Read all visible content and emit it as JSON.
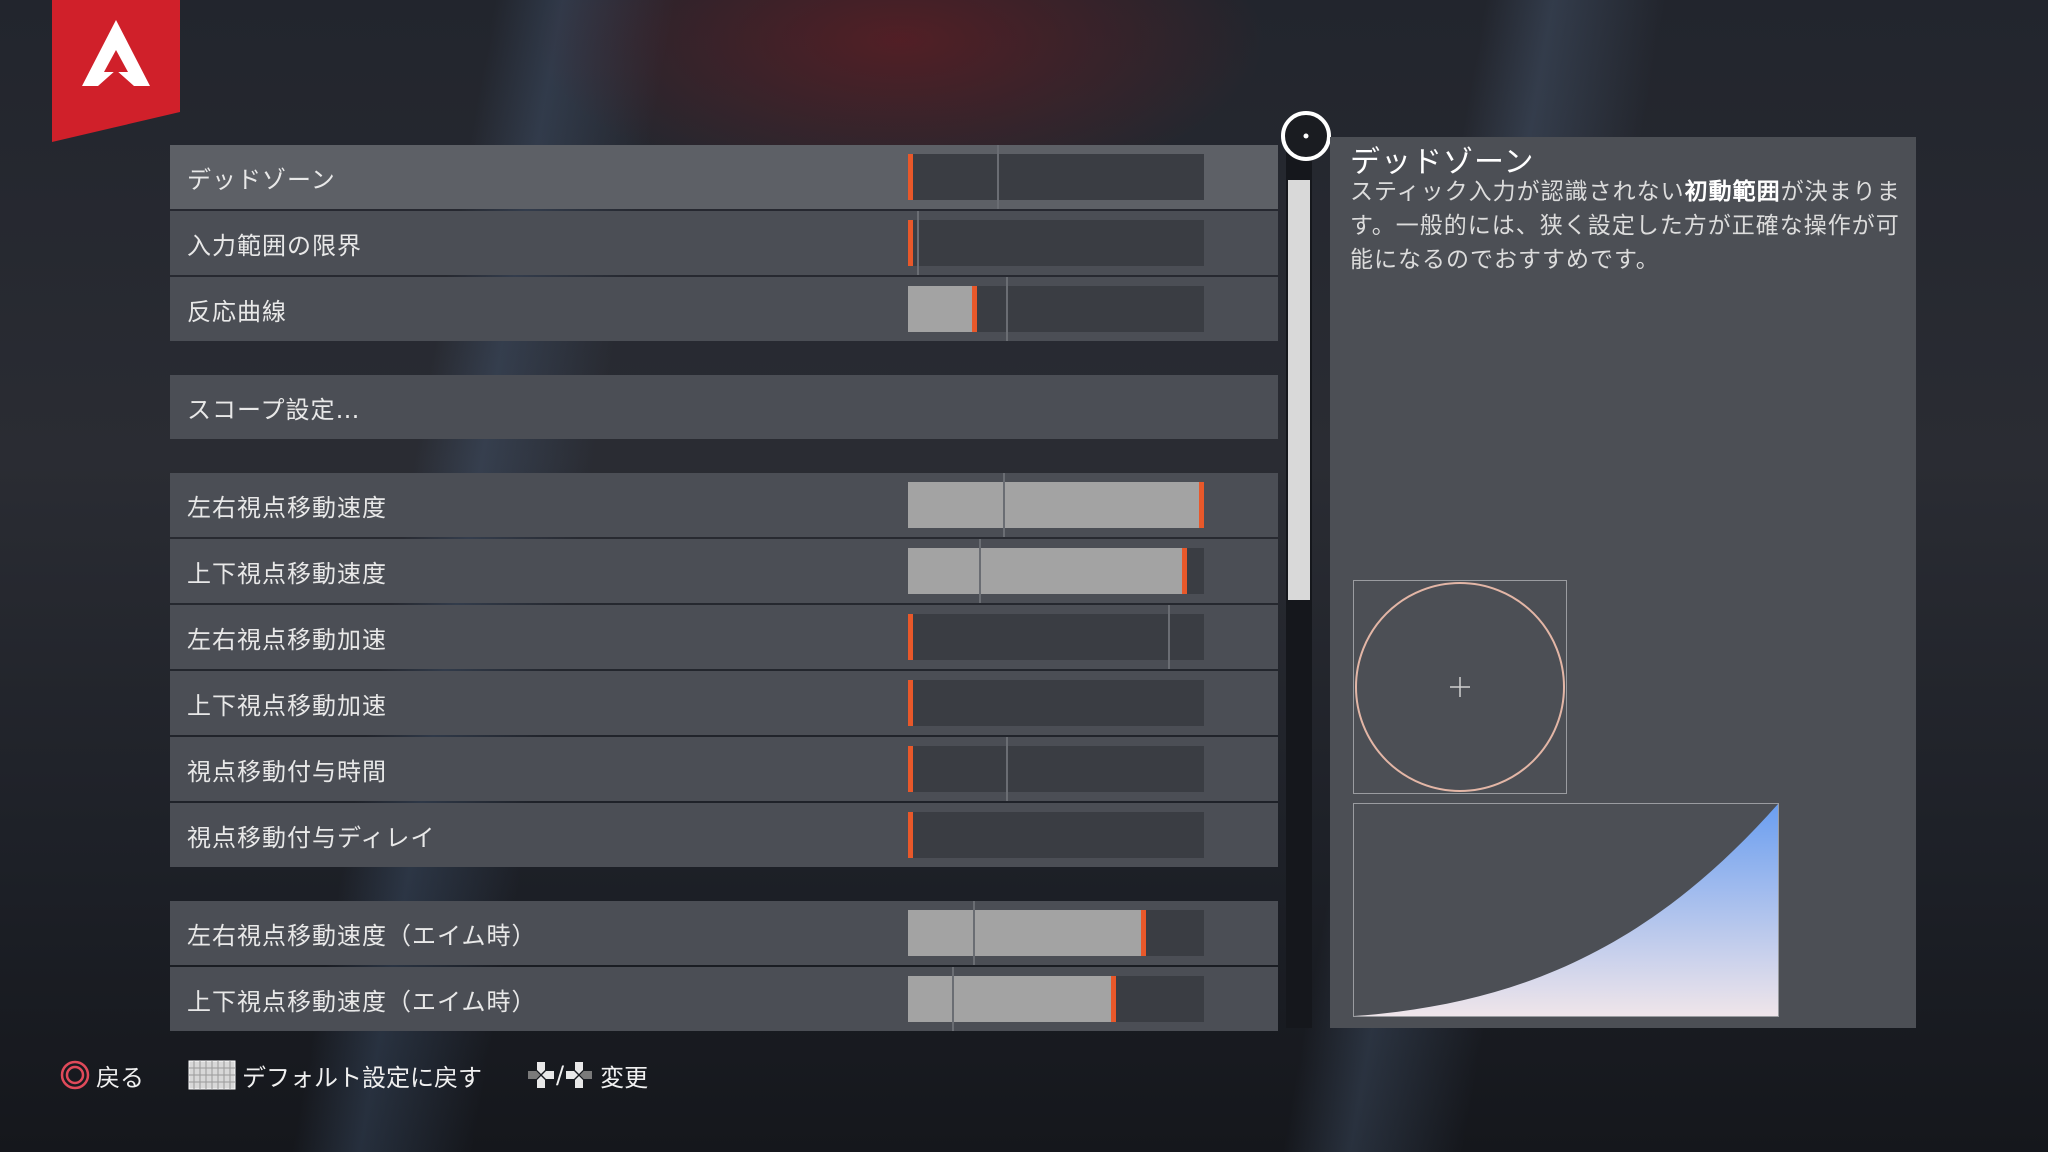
{
  "colors": {
    "accent": "#e8582a",
    "logo_red": "#d0202a",
    "row_bg": "#4b4e55",
    "panel_bg": "#4c4f55"
  },
  "logo": {
    "icon": "apex-logo-icon"
  },
  "settings": [
    {
      "type": "slider",
      "label": "デッドゾーン",
      "value": 0.0,
      "default": 0.3,
      "selected": true
    },
    {
      "type": "slider",
      "label": "入力範囲の限界",
      "value": 0.0,
      "default": 0.03
    },
    {
      "type": "slider",
      "label": "反応曲線",
      "value": 0.23,
      "default": 0.33
    },
    {
      "type": "gap"
    },
    {
      "type": "link",
      "label": "スコープ設定…"
    },
    {
      "type": "gap"
    },
    {
      "type": "slider",
      "label": "左右視点移動速度",
      "value": 1.0,
      "default": 0.32
    },
    {
      "type": "slider",
      "label": "上下視点移動速度",
      "value": 0.94,
      "default": 0.24
    },
    {
      "type": "slider",
      "label": "左右視点移動加速",
      "value": 0.0,
      "default": 0.88
    },
    {
      "type": "slider",
      "label": "上下視点移動加速",
      "value": 0.0,
      "default": null
    },
    {
      "type": "slider",
      "label": "視点移動付与時間",
      "value": 0.0,
      "default": 0.33
    },
    {
      "type": "slider",
      "label": "視点移動付与ディレイ",
      "value": 0.0,
      "default": null
    },
    {
      "type": "gap"
    },
    {
      "type": "slider",
      "label": "左右視点移動速度（エイム時）",
      "value": 0.8,
      "default": 0.22
    },
    {
      "type": "slider",
      "label": "上下視点移動速度（エイム時）",
      "value": 0.7,
      "default": 0.15
    }
  ],
  "info": {
    "title": "デッドゾーン",
    "desc_before": "スティック入力が認識されない",
    "desc_bold": "初動範囲",
    "desc_after": "が決まります。一般的には、狭く設定した方が正確な操作が可能になるのでおすすめです。"
  },
  "footer": {
    "back": {
      "icon": "circle-button-icon",
      "label": "戻る"
    },
    "reset": {
      "icon": "touchpad-icon",
      "label": "デフォルト設定に戻す"
    },
    "change": {
      "icon": "dpad-icon",
      "separator": "/",
      "label": "変更"
    }
  }
}
